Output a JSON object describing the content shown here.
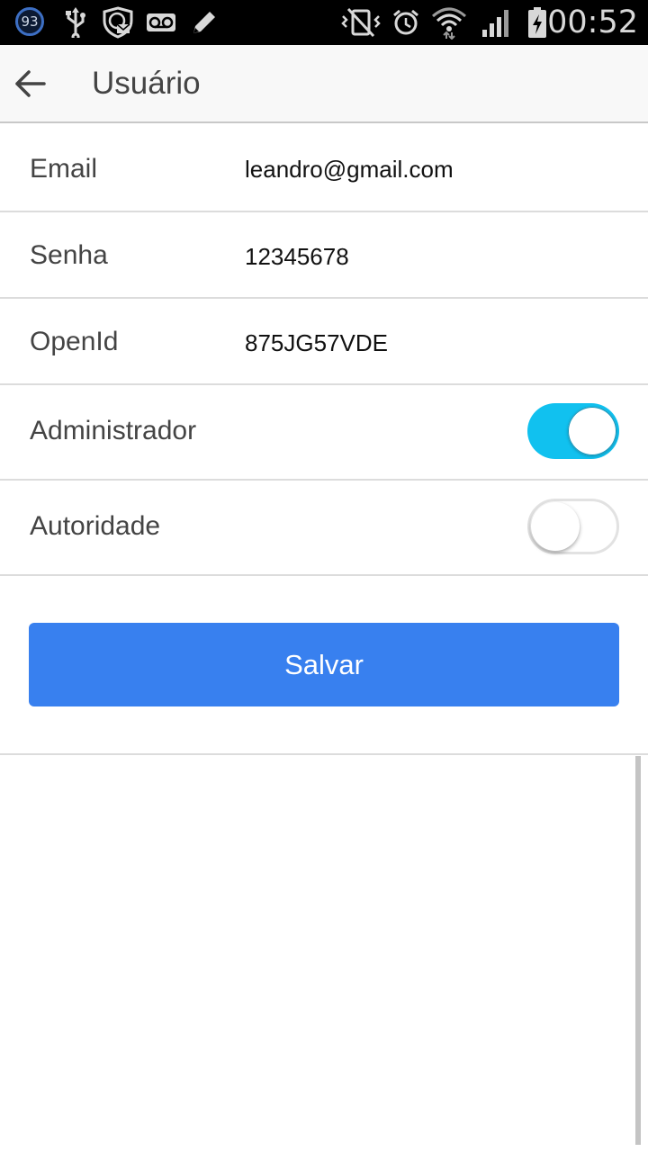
{
  "status_bar": {
    "notification_count": "93",
    "time": "00:52",
    "icons": [
      "notification-count-icon",
      "usb-icon",
      "security-mail-icon",
      "voicemail-icon",
      "pencil-icon",
      "vibrate-off-icon",
      "alarm-icon",
      "wifi-icon",
      "signal-icon",
      "battery-charging-icon"
    ]
  },
  "app_bar": {
    "title": "Usuário",
    "back_icon": "arrow-back-icon"
  },
  "form": {
    "email": {
      "label": "Email",
      "value": "leandro@gmail.com"
    },
    "senha": {
      "label": "Senha",
      "value": "12345678"
    },
    "openid": {
      "label": "OpenId",
      "value": "875JG57VDE"
    },
    "administrador": {
      "label": "Administrador",
      "checked": true
    },
    "autoridade": {
      "label": "Autoridade",
      "checked": false
    }
  },
  "actions": {
    "save_label": "Salvar"
  },
  "colors": {
    "toggle_on": "#11c1ef",
    "button": "#3880ef",
    "status_bar": "#000000",
    "app_bar": "#f8f8f8"
  }
}
